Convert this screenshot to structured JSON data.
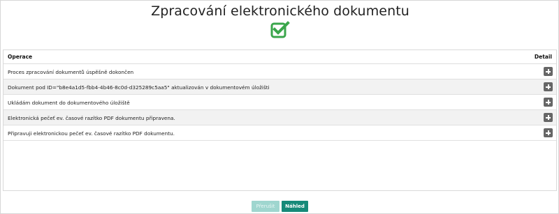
{
  "page": {
    "title": "Zpracování elektronického dokumentu"
  },
  "icons": {
    "status": "check-square-icon",
    "status_color": "#3aa64b",
    "detail": "plus-square-icon"
  },
  "table": {
    "header_operation": "Operace",
    "header_detail": "Detail",
    "rows": [
      {
        "text": "Proces zpracování dokumentů úspěšně dokončen"
      },
      {
        "text": "Dokument pod ID=\"b8e4a1d5-fbb4-4b46-8c0d-d325289c5aa5\" aktualizován v dokumentovém úložišti"
      },
      {
        "text": "Ukládám dokument do dokumentového úložiště"
      },
      {
        "text": "Elektronická pečeť ev. časové razítko PDF dokumentu připravena."
      },
      {
        "text": "Připravuji elektronickou pečeť ev. časové razítko PDF dokumentu."
      }
    ]
  },
  "footer": {
    "prev_label": "Přerušit",
    "preview_label": "Náhled",
    "accent": "#168a79"
  }
}
